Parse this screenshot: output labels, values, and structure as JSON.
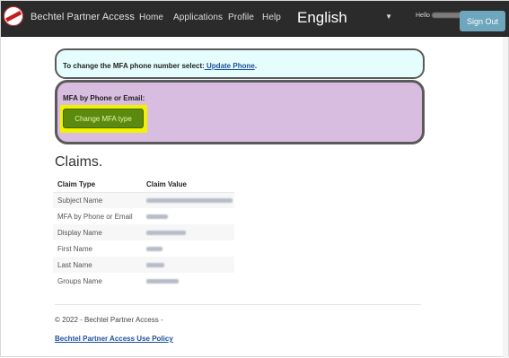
{
  "navbar": {
    "brand": "Bechtel Partner Access",
    "items": [
      "Home",
      "Applications",
      "Profile",
      "Help"
    ],
    "language": "English",
    "hello_label": "Hello",
    "sign_out": "Sign Out"
  },
  "update_panel": {
    "text": "To change the MFA phone number select:",
    "link": " Update Phone",
    "suffix": "."
  },
  "mfa_panel": {
    "title": "MFA by Phone or Email:",
    "button": "Change MFA type"
  },
  "claims": {
    "heading": "Claims.",
    "columns": [
      "Claim Type",
      "Claim Value"
    ],
    "rows": [
      "Subject Name",
      "MFA by Phone or Email",
      "Display Name",
      "First Name",
      "Last Name",
      "Groups Name"
    ]
  },
  "footer": {
    "copyright": "© 2022 - Bechtel Partner Access -",
    "policy_link": "Bechtel Partner Access Use Policy"
  },
  "colors": {
    "navbar": "#2b2b2b",
    "sign_out": "#6da6bd",
    "update_panel": "#e5fdfd",
    "mfa_panel": "#d9bde0",
    "mfa_button": "#5c8a0f",
    "highlight": "#f2f200",
    "link": "#1d4f9f"
  }
}
